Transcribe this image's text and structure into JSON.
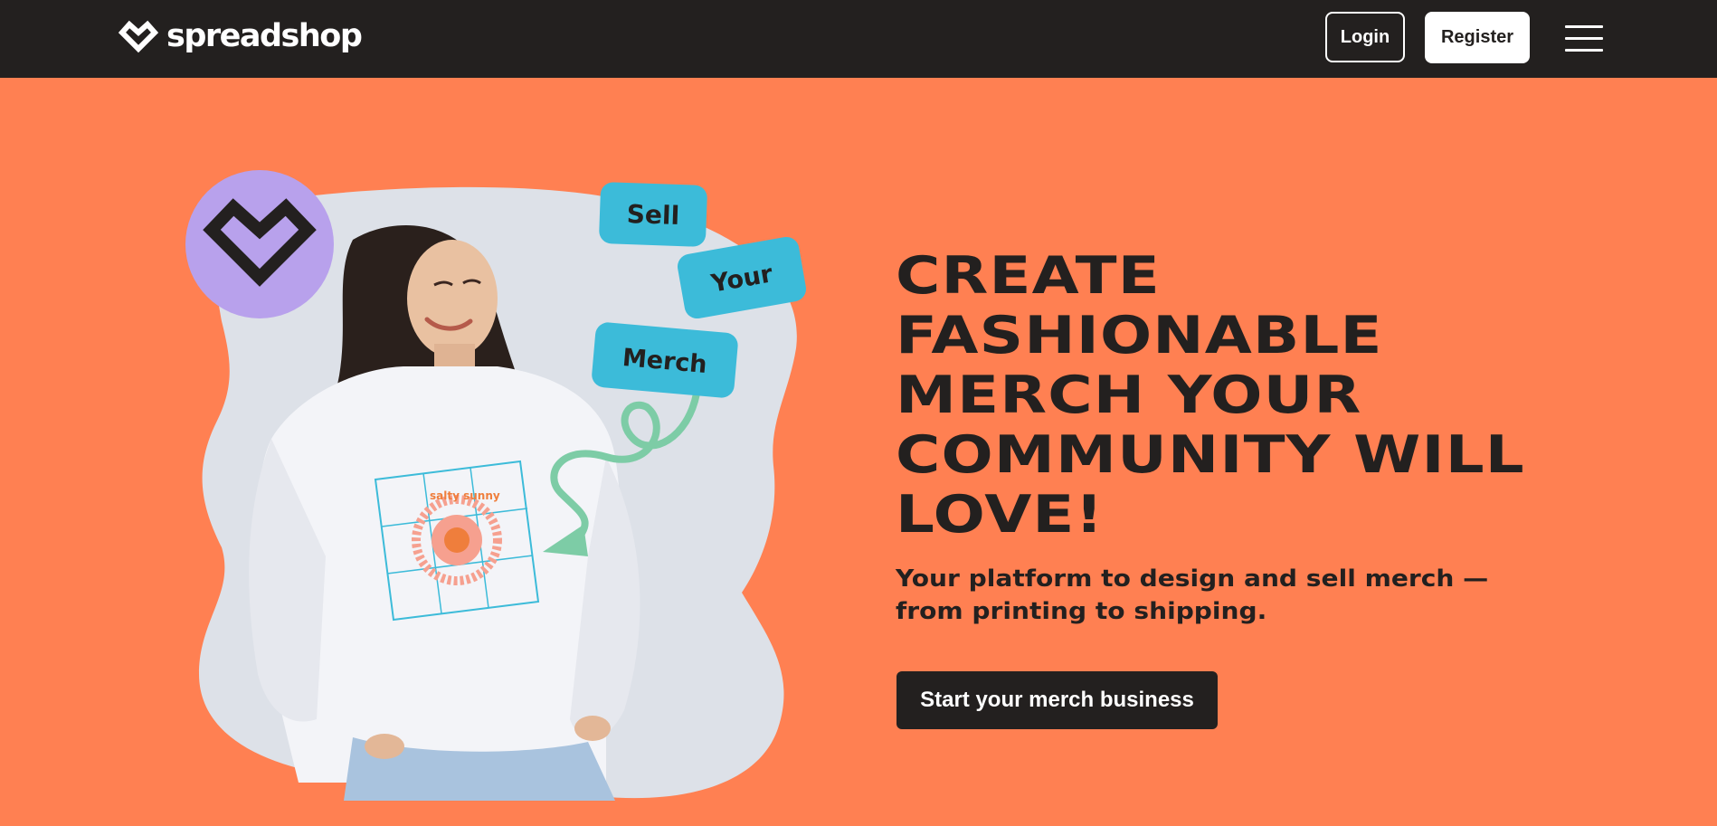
{
  "header": {
    "logo_text": "spreadshop",
    "login_label": "Login",
    "register_label": "Register"
  },
  "hero": {
    "headline_lines": [
      "CREATE",
      "FASHIONABLE",
      "MERCH YOUR",
      "COMMUNITY WILL",
      "LOVE!"
    ],
    "subheadline_lines": [
      "Your platform to design and sell merch —",
      "from printing to shipping."
    ],
    "cta_label": "Start your merch business",
    "tags": [
      "Sell",
      "Your",
      "Merch"
    ],
    "shirt_print_text": "salty sunny"
  },
  "colors": {
    "background": "#ff8052",
    "topbar": "#23201f",
    "text_dark": "#23201f",
    "tag_blue": "#3cbbd9",
    "badge_purple": "#b8a1ec",
    "arrow_green": "#7dcca6"
  },
  "icons": [
    "heart-logo-icon",
    "hamburger-menu-icon",
    "arrow-icon"
  ]
}
